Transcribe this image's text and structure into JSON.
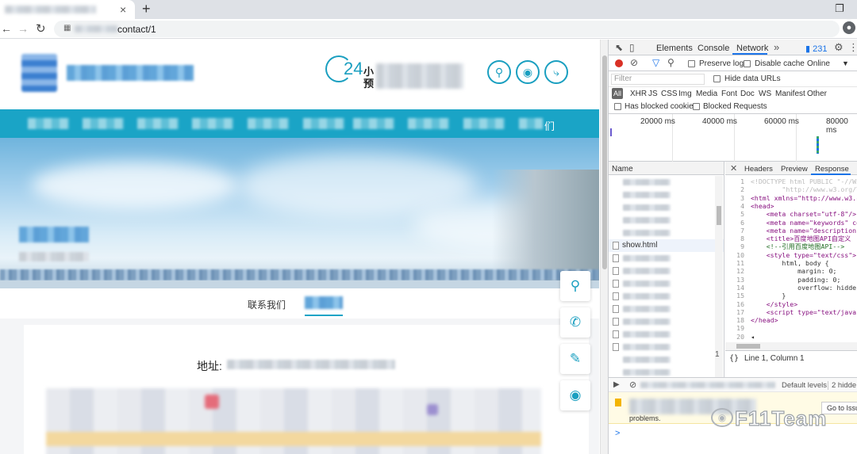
{
  "browser": {
    "tab_close": "×",
    "new_tab": "+",
    "window_maximize": "❐",
    "nav_back": "←",
    "nav_forward": "→",
    "nav_reload": "↻",
    "address_visible": "contact/1",
    "star": "☆",
    "profile_icon": "user-icon"
  },
  "site": {
    "hotline": {
      "number": "24",
      "line1": "小",
      "line2": "预"
    },
    "header_icons": [
      "search-icon",
      "wechat-icon",
      "share-icon"
    ],
    "nav_last_visible": "们",
    "subtabs": {
      "active_left": "联系我们"
    },
    "address_label": "地址:",
    "float_buttons": [
      "location-icon",
      "phone-icon",
      "note-icon",
      "wechat-icon"
    ],
    "colors": {
      "accent": "#1aa4c6",
      "icon": "#1a9fc0"
    }
  },
  "devtools": {
    "tabs": [
      "Elements",
      "Console",
      "Network"
    ],
    "active_tab": "Network",
    "more": "»",
    "issues_count": "231",
    "toolbar": {
      "preserve_log": "Preserve log",
      "disable_cache": "Disable cache",
      "throttle": "Online"
    },
    "filter_placeholder": "Filter",
    "hide_data_urls": "Hide data URLs",
    "types": [
      "All",
      "XHR",
      "JS",
      "CSS",
      "Img",
      "Media",
      "Font",
      "Doc",
      "WS",
      "Manifest",
      "Other"
    ],
    "has_blocked_cookies": "Has blocked cookies",
    "blocked_requests": "Blocked Requests",
    "timeline_ticks": [
      "20000 ms",
      "40000 ms",
      "60000 ms",
      "80000 ms"
    ],
    "name_header": "Name",
    "visible_request": "show.html",
    "detail_tabs": [
      "Headers",
      "Preview",
      "Response"
    ],
    "active_detail_tab": "Response",
    "code_lines": [
      {
        "n": "1",
        "t": "<!DOCTYPE html PUBLIC \"-//W3"
      },
      {
        "n": "2",
        "t": "        \"http://www.w3.org/T"
      },
      {
        "n": "3",
        "t": "<html xmlns=\"http://www.w3.c"
      },
      {
        "n": "4",
        "t": "<head>"
      },
      {
        "n": "5",
        "t": "    <meta charset=\"utf-8\"/>"
      },
      {
        "n": "6",
        "t": "    <meta name=\"keywords\" co"
      },
      {
        "n": "7",
        "t": "    <meta name=\"description\""
      },
      {
        "n": "8",
        "t": "    <title>百度地图API自定义"
      },
      {
        "n": "9",
        "t": "    <!--引用百度地图API-->"
      },
      {
        "n": "10",
        "t": "    <style type=\"text/css\">"
      },
      {
        "n": "11",
        "t": "        html, body {"
      },
      {
        "n": "12",
        "t": "            margin: 0;"
      },
      {
        "n": "13",
        "t": "            padding: 0;"
      },
      {
        "n": "14",
        "t": "            overflow: hidde"
      },
      {
        "n": "15",
        "t": "        }"
      },
      {
        "n": "16",
        "t": "    </style>"
      },
      {
        "n": "17",
        "t": "    <script type=\"text/javas"
      },
      {
        "n": "18",
        "t": "</head>"
      },
      {
        "n": "19",
        "t": ""
      },
      {
        "n": "20",
        "t": "◂"
      }
    ],
    "status_braces": "{}",
    "cursor_position": "Line 1, Column 1",
    "left_line_indicator": "1",
    "console": {
      "levels": "Default levels",
      "hidden": "2 hidde",
      "goto": "Go to Issu",
      "msg_tail": "problems.",
      "prompt": ">"
    }
  },
  "watermark": "F11Team"
}
